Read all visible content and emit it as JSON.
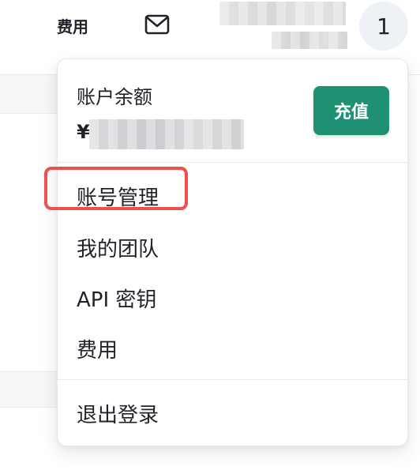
{
  "topbar": {
    "fee_label": "费用",
    "avatar_text": "1"
  },
  "dropdown": {
    "balance_label": "账户余额",
    "currency_symbol": "¥",
    "recharge_label": "充值",
    "items": [
      {
        "label": "账号管理"
      },
      {
        "label": "我的团队"
      },
      {
        "label": "API 密钥"
      },
      {
        "label": "费用"
      }
    ],
    "logout_label": "退出登录"
  },
  "colors": {
    "recharge_bg": "#1f9173",
    "highlight_border": "#ee4f4f"
  },
  "icons": {
    "mail": "envelope-icon"
  }
}
